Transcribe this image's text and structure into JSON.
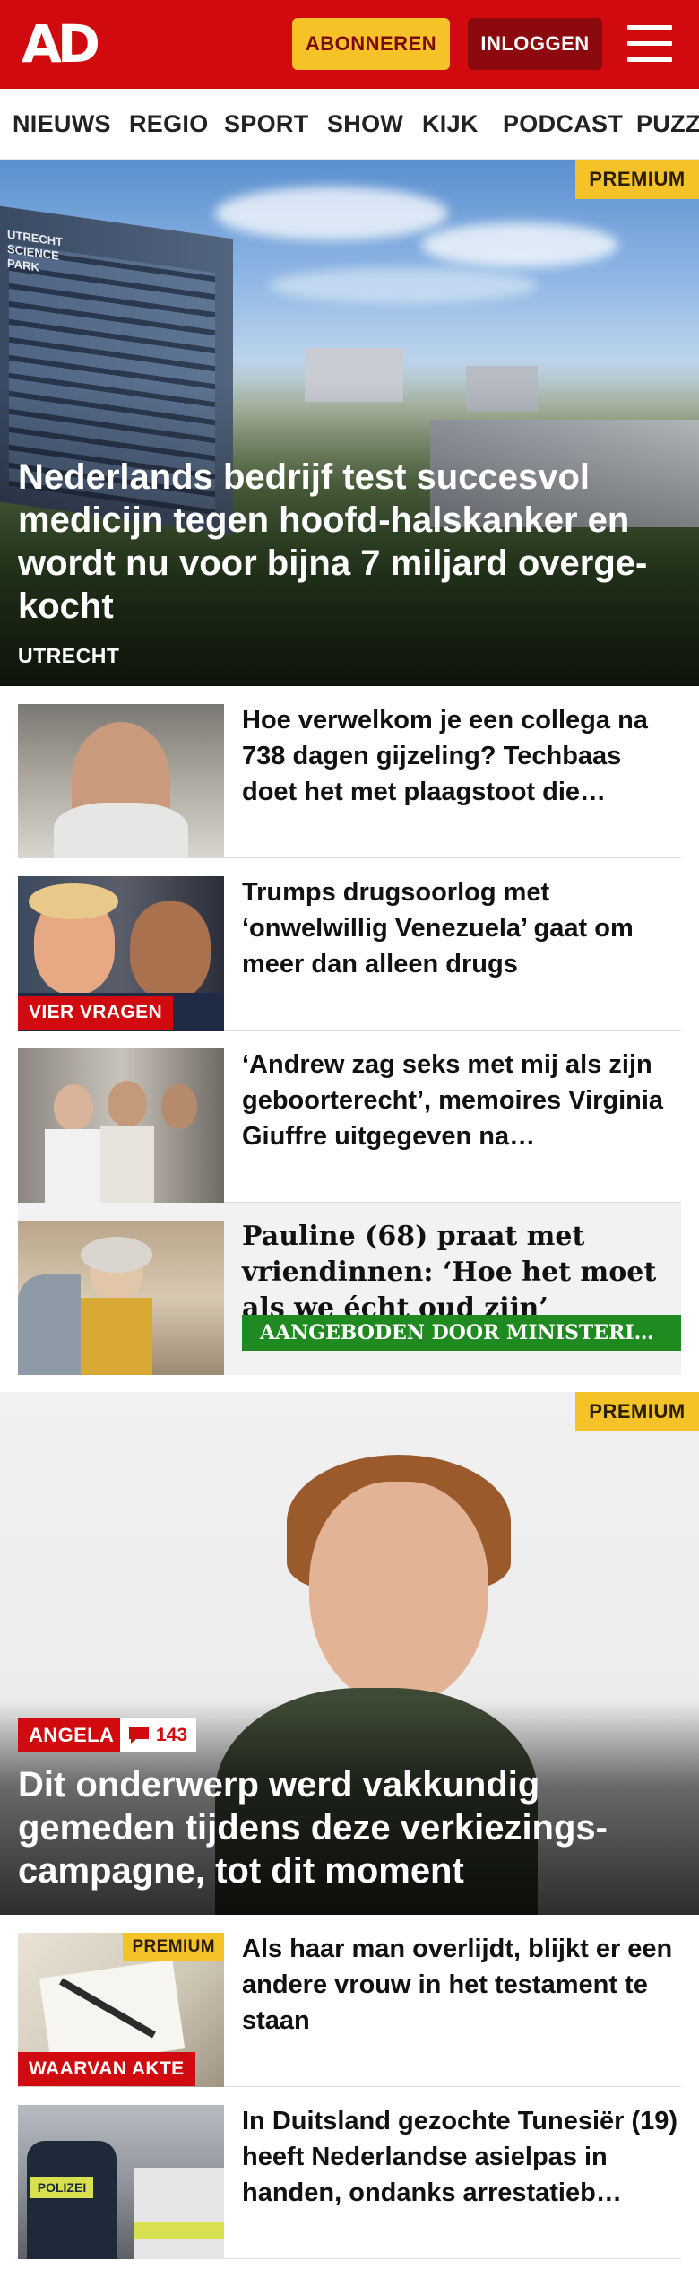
{
  "header": {
    "logo": "AD",
    "subscribe_label": "ABONNEREN",
    "login_label": "INLOGGEN",
    "brand_color": "#d10a10",
    "accent_color": "#f5c228"
  },
  "nav": {
    "items": [
      "NIEUWS",
      "REGIO",
      "SPORT",
      "SHOW",
      "KIJK",
      "PODCAST",
      "PUZZ"
    ]
  },
  "hero": {
    "premium_label": "PREMIUM",
    "title": "Nederlands bedrijf test succesvol medicijn tegen hoofd-halskanker en wordt nu voor bijna 7 miljard overge-kocht",
    "location": "UTRECHT",
    "sign_text": "UTRECHT SCIENCE PARK"
  },
  "articles": [
    {
      "title": "Hoe verwelkom je een collega na 738 dagen gijzeling? Techbaas doet het met plaagstoot die…",
      "label": ""
    },
    {
      "title": "Trumps drugsoorlog met ‘onwelwillig Venezuela’ gaat om meer dan alleen drugs",
      "label": "VIER VRAGEN"
    },
    {
      "title": "‘Andrew zag seks met mij als zijn geboorterecht’, memoires Virginia Giuffre uitgegeven na…",
      "label": ""
    },
    {
      "title": "Pauline (68) praat met vriendinnen: ‘Hoe het moet als we écht oud zijn’",
      "sponsor": "AANGEBODEN DOOR MINISTERIE …"
    }
  ],
  "feature": {
    "premium_label": "PREMIUM",
    "tag": "ANGELA",
    "comments": "143",
    "title": "Dit onderwerp werd vakkundig gemeden tijdens deze verkiezings-campagne, tot dit moment"
  },
  "articles2": [
    {
      "title": "Als haar man overlijdt, blijkt er een andere vrouw in het testament te staan",
      "label": "WAARVAN AKTE",
      "premium_label": "PREMIUM"
    },
    {
      "title": "In Duitsland gezochte Tunesiër (19) heeft Nederlandse asielpas in handen, ondanks arrestatieb…",
      "thumb_text": "POLIZEI"
    }
  ]
}
